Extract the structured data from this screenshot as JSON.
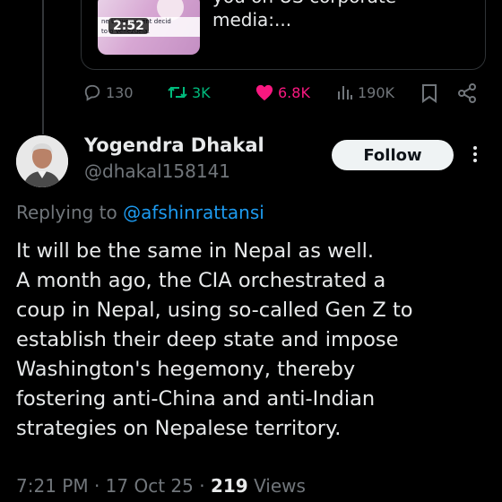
{
  "quoted": {
    "duration": "2:52",
    "thumb_caption_1": "ne U   overnment decid",
    "thumb_caption_2": "to    o Venezuela.",
    "text": "you on US corporate\nmedia:..."
  },
  "actions": {
    "replies": "130",
    "reposts": "3K",
    "likes": "6.8K",
    "views": "190K"
  },
  "reply": {
    "author_name": "Yogendra Dhakal",
    "author_handle": "@dhakal158141",
    "follow_label": "Follow",
    "replying_to_prefix": "Replying to ",
    "replying_to_handle": "@afshinrattansi",
    "body": "It will be the same in Nepal as well.\nA month ago, the CIA orchestrated a\ncoup in Nepal, using so-called Gen Z to\nestablish their deep state and impose\nWashington's hegemony, thereby\nfostering anti-China and anti-Indian\nstrategies on Nepalese territory.",
    "time": "7:21 PM",
    "date": "17 Oct 25",
    "views_count": "219",
    "views_label": "Views"
  },
  "colors": {
    "background": "#000000",
    "text": "#e7e9ea",
    "muted": "#71767b",
    "link": "#1d9bf0",
    "repost": "#00ba7c",
    "like": "#f91880"
  }
}
